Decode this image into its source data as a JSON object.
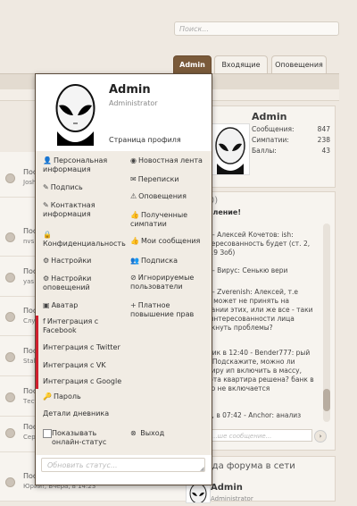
{
  "search": {
    "placeholder": "Поиск..."
  },
  "tabs": [
    {
      "label": "Admin"
    },
    {
      "label": "Входящие"
    },
    {
      "label": "Оповещения"
    }
  ],
  "threads": [
    {
      "title": "Пос",
      "sub": "Josh"
    },
    {
      "title": "Пос",
      "sub": "nvs"
    },
    {
      "title": "Пос",
      "sub": "yas"
    },
    {
      "title": "Пос",
      "sub": "Слу"
    },
    {
      "title": "Пос",
      "sub": "Stal"
    },
    {
      "title": "Пос",
      "sub": "Тест"
    },
    {
      "title": "Пос",
      "sub": "Сергей, Вчера, в 15:"
    },
    {
      "title": "Пос",
      "sub": "Юрий!, Вчера, в 14:23"
    }
  ],
  "profile_card": {
    "name": "Admin",
    "stats": [
      {
        "label": "Сообщения:",
        "value": "847"
      },
      {
        "label": "Симпатии:",
        "value": "238"
      },
      {
        "label": "Баллы:",
        "value": "43"
      }
    ]
  },
  "chat": {
    "title": "Чат (0)",
    "update": "Обновление!",
    "messages": [
      "08:29 - Алексей Кочетов: ish: заинтересованность будет (ст. 2, 3 ст. 19 Зоб)",
      "11:36 - Вирус: Сенькю вери",
      "14:40 - Zverenish: Алексей, т.е судья может не принять на основании этих, или же все - таки по заинтересованности лица возникнуть проблемы?",
      "Вторник в 12:40 - Bender777: рый день. Подскажите, можно ли квартиру ип включить в массу, если эта квартира решена? банк в реестр не включается",
      "Вчера, в 07:42 - Anchor: анализ"
    ],
    "input_placeholder": "...ше сообщение..."
  },
  "online": {
    "title": "...ада форума в сети",
    "name": "Admin",
    "role": "Administrator"
  },
  "menu": {
    "name": "Admin",
    "role": "Administrator",
    "profile_link": "Страница профиля",
    "left": [
      {
        "icon": "person-icon",
        "glyph": "👤",
        "label": "Персональная информация"
      },
      {
        "icon": "signature-icon",
        "glyph": "✎",
        "label": "Подпись"
      },
      {
        "icon": "contact-icon",
        "glyph": "✎",
        "label": "Контактная информация"
      },
      {
        "icon": "lock-icon",
        "glyph": "🔒",
        "label": "Конфиденциальность"
      },
      {
        "icon": "gear-icon",
        "glyph": "⚙",
        "label": "Настройки"
      },
      {
        "icon": "alerts-settings-icon",
        "glyph": "⚙",
        "label": "Настройки оповещений"
      },
      {
        "icon": "image-icon",
        "glyph": "▣",
        "label": "Аватар"
      },
      {
        "icon": "facebook-icon",
        "glyph": "f",
        "label": "Интеграция с Facebook"
      },
      {
        "icon": "twitter-icon",
        "glyph": "",
        "label": "Интеграция с Twitter"
      },
      {
        "icon": "vk-icon",
        "glyph": "",
        "label": "Интеграция с VK"
      },
      {
        "icon": "google-icon",
        "glyph": "",
        "label": "Интеграция с Google"
      },
      {
        "icon": "key-icon",
        "glyph": "🔑",
        "label": "Пароль"
      },
      {
        "icon": "",
        "glyph": "",
        "label": "Детали дневника"
      }
    ],
    "right": [
      {
        "icon": "rss-icon",
        "glyph": "◉",
        "label": "Новостная лента"
      },
      {
        "icon": "envelope-icon",
        "glyph": "✉",
        "label": "Переписки"
      },
      {
        "icon": "alert-icon",
        "glyph": "⚠",
        "label": "Оповещения"
      },
      {
        "icon": "thumbs-up-icon",
        "glyph": "👍",
        "label": "Полученные симпатии"
      },
      {
        "icon": "thumbs-up-icon",
        "glyph": "👍",
        "label": "Мои сообщения"
      },
      {
        "icon": "subscribe-icon",
        "glyph": "👥",
        "label": "Подписка"
      },
      {
        "icon": "ignore-icon",
        "glyph": "⊘",
        "label": "Игнорируемые пользователи"
      },
      {
        "icon": "paid-upgrade-icon",
        "glyph": "+",
        "label": "Платное повышение прав"
      }
    ],
    "show_online_label": "Показывать онлайн-статус",
    "logout_label": "Выход",
    "logout_glyph": "⊗",
    "status_placeholder": "Обновить статус..."
  }
}
